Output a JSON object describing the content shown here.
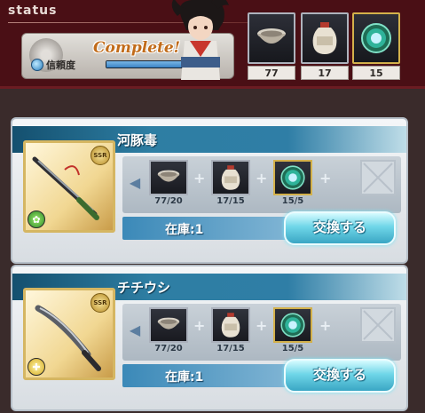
{
  "status": {
    "title": "status",
    "complete_text": "Complete!",
    "trust_label": "信頼度",
    "trust_level": 1.0,
    "items": [
      {
        "icon": "bowl-icon",
        "count": "77"
      },
      {
        "icon": "jar-icon",
        "count": "17"
      },
      {
        "icon": "orb-icon",
        "count": "15"
      }
    ]
  },
  "cards": [
    {
      "name": "河豚毒",
      "weapon_icon": "katana-icon",
      "rarity": "SSR",
      "element": "wind",
      "materials": [
        {
          "icon": "bowl-icon",
          "count": "77/20"
        },
        {
          "icon": "jar-icon",
          "count": "17/15"
        },
        {
          "icon": "orb-icon",
          "count": "15/5"
        }
      ],
      "stock": "在庫:1",
      "button_label": "交換する"
    },
    {
      "name": "チチウシ",
      "weapon_icon": "blade-icon",
      "rarity": "SSR",
      "element": "light",
      "materials": [
        {
          "icon": "bowl-icon",
          "count": "77/20"
        },
        {
          "icon": "jar-icon",
          "count": "17/15"
        },
        {
          "icon": "orb-icon",
          "count": "15/5"
        }
      ],
      "stock": "在庫:1",
      "button_label": "交換する"
    }
  ],
  "colors": {
    "panel_bg": "#4a0f15",
    "header_blue": "#2e7ea3",
    "button_cyan": "#6fd6e8"
  }
}
